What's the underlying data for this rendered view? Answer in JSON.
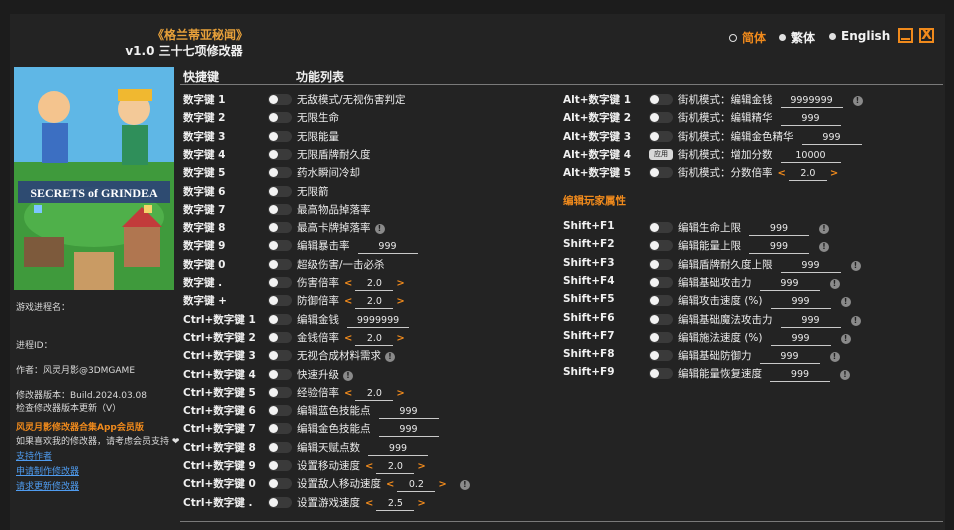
{
  "header": {
    "title_cn": "《格兰蒂亚秘闻》",
    "title_version": "v1.0 三十七项修改器"
  },
  "languages": [
    {
      "label": "简体",
      "active": true
    },
    {
      "label": "繁体",
      "active": false
    },
    {
      "label": "English",
      "active": false
    }
  ],
  "window_controls": {
    "close_glyph": "X"
  },
  "game_art": {
    "logo_text": "SECRETS of GRINDEA"
  },
  "sidebar": {
    "process_label": "游戏进程名：",
    "pid_label": "进程ID：",
    "author": "作者：风灵月影@3DMGAME",
    "version": "修改器版本：Build.2024.03.08",
    "check_update": "检查修改器版本更新（V）",
    "app_promo": "风灵月影修改器合集App会员版",
    "support_text": "如果喜欢我的修改器，请考虑会员支持",
    "links": [
      "支持作者",
      "申请制作修改器",
      "请求更新修改器"
    ]
  },
  "columns": {
    "hotkeys": "快捷键",
    "functions": "功能列表"
  },
  "section_title": "编辑玩家属性",
  "left_rows": [
    {
      "key": "数字键 1",
      "label": "无敌模式/无视伤害判定"
    },
    {
      "key": "数字键 2",
      "label": "无限生命"
    },
    {
      "key": "数字键 3",
      "label": "无限能量"
    },
    {
      "key": "数字键 4",
      "label": "无限盾牌耐久度"
    },
    {
      "key": "数字键 5",
      "label": "药水瞬间冷却"
    },
    {
      "key": "数字键 6",
      "label": "无限箭"
    },
    {
      "key": "数字键 7",
      "label": "最高物品掉落率"
    },
    {
      "key": "数字键 8",
      "label": "最高卡牌掉落率",
      "info": true
    },
    {
      "key": "数字键 9",
      "label": "编辑暴击率",
      "value": "999"
    },
    {
      "key": "数字键 0",
      "label": "超级伤害/一击必杀"
    },
    {
      "key": "数字键 .",
      "label": "伤害倍率",
      "value": "2.0",
      "stepper": true
    },
    {
      "key": "数字键 +",
      "label": "防御倍率",
      "value": "2.0",
      "stepper": true
    },
    {
      "key": "Ctrl+数字键 1",
      "label": "编辑金钱",
      "value": "9999999"
    },
    {
      "key": "Ctrl+数字键 2",
      "label": "金钱倍率",
      "value": "2.0",
      "stepper": true
    },
    {
      "key": "Ctrl+数字键 3",
      "label": "无视合成材料需求",
      "info": true
    },
    {
      "key": "Ctrl+数字键 4",
      "label": "快速升级",
      "info": true
    },
    {
      "key": "Ctrl+数字键 5",
      "label": "经验倍率",
      "value": "2.0",
      "stepper": true
    },
    {
      "key": "Ctrl+数字键 6",
      "label": "编辑蓝色技能点",
      "value": "999"
    },
    {
      "key": "Ctrl+数字键 7",
      "label": "编辑金色技能点",
      "value": "999"
    },
    {
      "key": "Ctrl+数字键 8",
      "label": "编辑天赋点数",
      "value": "999"
    },
    {
      "key": "Ctrl+数字键 9",
      "label": "设置移动速度",
      "value": "2.0",
      "stepper": true
    },
    {
      "key": "Ctrl+数字键 0",
      "label": "设置敌人移动速度",
      "value": "0.2",
      "stepper": true,
      "info": true
    },
    {
      "key": "Ctrl+数字键 .",
      "label": "设置游戏速度",
      "value": "2.5",
      "stepper": true
    }
  ],
  "right_rows": [
    {
      "key": "Alt+数字键 1",
      "label": "街机模式：编辑金钱",
      "value": "9999999",
      "info": true
    },
    {
      "key": "Alt+数字键 2",
      "label": "街机模式：编辑精华",
      "value": "999"
    },
    {
      "key": "Alt+数字键 3",
      "label": "街机模式：编辑金色精华",
      "value": "999"
    },
    {
      "key": "Alt+数字键 4",
      "label": "街机模式：增加分数",
      "value": "10000",
      "apply": "应用"
    },
    {
      "key": "Alt+数字键 5",
      "label": "街机模式：分数倍率",
      "value": "2.0",
      "stepper": true
    }
  ],
  "shift_rows": [
    {
      "key": "Shift+F1",
      "label": "编辑生命上限",
      "value": "999",
      "info": true
    },
    {
      "key": "Shift+F2",
      "label": "编辑能量上限",
      "value": "999",
      "info": true
    },
    {
      "key": "Shift+F3",
      "label": "编辑盾牌耐久度上限",
      "value": "999",
      "info": true
    },
    {
      "key": "Shift+F4",
      "label": "编辑基础攻击力",
      "value": "999",
      "info": true
    },
    {
      "key": "Shift+F5",
      "label": "编辑攻击速度 (%)",
      "value": "999",
      "info": true
    },
    {
      "key": "Shift+F6",
      "label": "编辑基础魔法攻击力",
      "value": "999",
      "info": true
    },
    {
      "key": "Shift+F7",
      "label": "编辑施法速度 (%)",
      "value": "999",
      "info": true
    },
    {
      "key": "Shift+F8",
      "label": "编辑基础防御力",
      "value": "999",
      "info": true
    },
    {
      "key": "Shift+F9",
      "label": "编辑能量恢复速度",
      "value": "999",
      "info": true
    }
  ],
  "colors": {
    "accent": "#f08a1c",
    "link": "#4f9cf0",
    "background": "#232323"
  }
}
